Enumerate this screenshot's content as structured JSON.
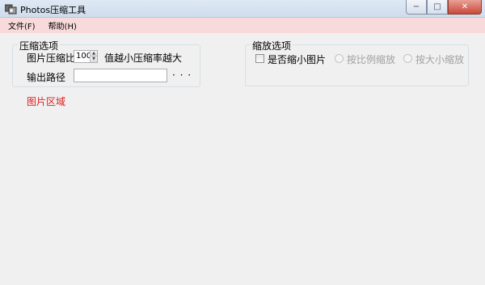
{
  "window": {
    "title": "Photos压缩工具",
    "minimize_glyph": "−",
    "maximize_glyph": "□",
    "close_glyph": "✕"
  },
  "menu": {
    "items": [
      {
        "label": "文件(F)"
      },
      {
        "label": "帮助(H)"
      }
    ]
  },
  "compress_options": {
    "legend": "压缩选项",
    "ratio_label": "图片压缩比",
    "ratio_value": "100",
    "ratio_hint": "值越小压缩率越大",
    "output_label": "输出路径",
    "output_value": "",
    "browse_label": "· · ·"
  },
  "scale_options": {
    "legend": "缩放选项",
    "enable_label": "是否缩小图片",
    "enable_checked": false,
    "by_ratio_label": "按比例缩放",
    "by_size_label": "按大小缩放"
  },
  "image_area": {
    "label": "图片区域",
    "color": "#e01e1e"
  }
}
